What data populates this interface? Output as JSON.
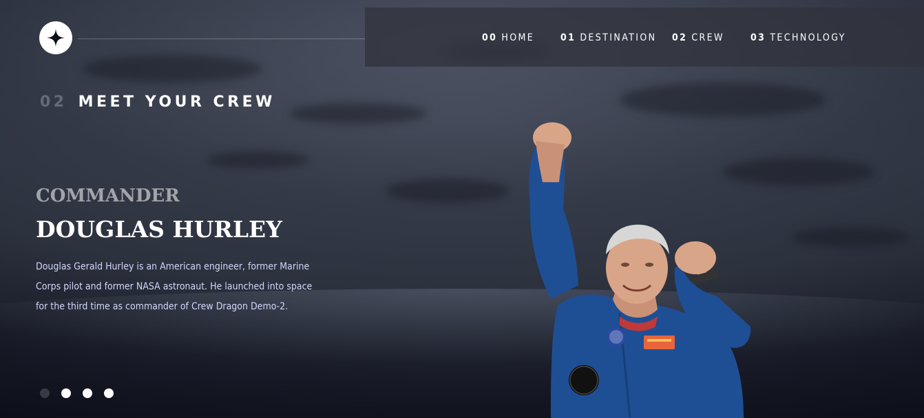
{
  "header": {
    "logo_icon": "star-icon",
    "nav": [
      {
        "num": "00",
        "label": "HOME"
      },
      {
        "num": "01",
        "label": "DESTINATION"
      },
      {
        "num": "02",
        "label": "CREW"
      },
      {
        "num": "03",
        "label": "TECHNOLOGY"
      }
    ],
    "active_index": 2
  },
  "page": {
    "num": "02",
    "title": "MEET YOUR CREW"
  },
  "crew": {
    "role": "Commander",
    "name": "Douglas Hurley",
    "bio": "Douglas Gerald Hurley is an American engineer, former Marine Corps pilot and former NASA astronaut. He launched into space for the third time as commander of Crew Dragon Demo-2.",
    "image": "astronaut-photo"
  },
  "carousel": {
    "count": 4,
    "active_index": 0
  },
  "colors": {
    "background": "#0b0d17",
    "text": "#ffffff",
    "bio_text": "#d0d6f9",
    "suit_blue": "#1e4f95"
  }
}
